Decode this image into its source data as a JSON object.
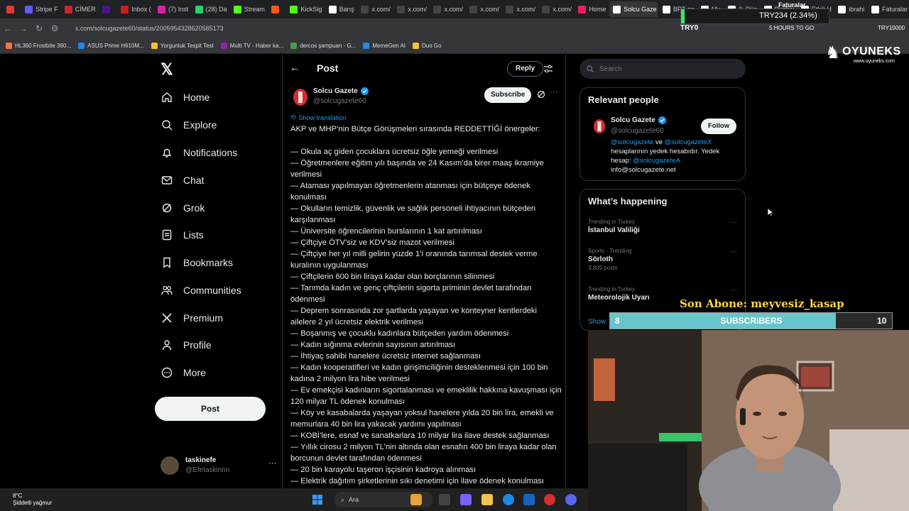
{
  "browser": {
    "tabs": [
      {
        "label": "",
        "color": "#e53935"
      },
      {
        "label": "Stripe F",
        "color": "#635bff"
      },
      {
        "label": "CİMER",
        "color": "#c62828"
      },
      {
        "label": "",
        "color": "#4a148c"
      },
      {
        "label": "Inbox (",
        "color": "#c5221f"
      },
      {
        "label": "(7) Inst",
        "color": "#d6249f"
      },
      {
        "label": "(28) Da",
        "color": "#25d366"
      },
      {
        "label": "Stream",
        "color": "#53fc18"
      },
      {
        "label": "",
        "color": "#ff5722"
      },
      {
        "label": "KickSig",
        "color": "#53fc18"
      },
      {
        "label": "Barış",
        "color": "#fff"
      },
      {
        "label": "x.com/",
        "color": "#444"
      },
      {
        "label": "x.com/",
        "color": "#444"
      },
      {
        "label": "x.com/",
        "color": "#444"
      },
      {
        "label": "x.com/",
        "color": "#444"
      },
      {
        "label": "x.com/",
        "color": "#444"
      },
      {
        "label": "x.com/",
        "color": "#444"
      },
      {
        "label": "Home",
        "color": "#e91e63"
      },
      {
        "label": "Solcu Gaze",
        "color": "#fff",
        "active": true
      },
      {
        "label": "BPT on",
        "color": "#fff"
      },
      {
        "label": "Mu",
        "color": "#fff"
      },
      {
        "label": "3. Dün",
        "color": "#fff"
      },
      {
        "label": "Puzhoi",
        "color": "#fff"
      },
      {
        "label": "Etkili H",
        "color": "#fff"
      },
      {
        "label": "ibrahi",
        "color": "#fff"
      },
      {
        "label": "Faturalar",
        "color": "#fff"
      }
    ],
    "url": "x.com/solcugazete60/status/2005954328620585173",
    "bookmarks": [
      {
        "label": "HL360 Frostbite 360...",
        "color": "#ff7043"
      },
      {
        "label": "ASUS Prime H610M...",
        "color": "#1e88e5"
      },
      {
        "label": "Yorgunluk Tespit Test",
        "color": "#fbc02d"
      },
      {
        "label": "Multi TV - Haber ka...",
        "color": "#8e24aa"
      },
      {
        "label": "dercos şampuan - G...",
        "color": "#43a047"
      },
      {
        "label": "MemeGen AI",
        "color": "#1e88e5"
      },
      {
        "label": "Duo Go",
        "color": "#fbc02d"
      }
    ]
  },
  "overlay": {
    "faturalar": "Faturalar",
    "ticker_value": "TRY234 (2.34%)",
    "ticker_progress": 0.0234,
    "ticker_sub": "TRY0",
    "hours_left": "5 HOURS TO GO",
    "ticker_goal": "TRY10000",
    "brand": "OYUNEKS",
    "brand_url": "www.oyuneks.com",
    "last_sub_label": "Son Abone: meyvesiz_kasap",
    "sub_current": "8",
    "sub_title": "SUBSCRIBERS",
    "sub_goal": "10",
    "sub_progress": 0.8
  },
  "sidebar": {
    "items": [
      {
        "label": "Home",
        "icon": "home-icon"
      },
      {
        "label": "Explore",
        "icon": "search-icon"
      },
      {
        "label": "Notifications",
        "icon": "bell-icon"
      },
      {
        "label": "Chat",
        "icon": "envelope-icon"
      },
      {
        "label": "Grok",
        "icon": "grok-icon"
      },
      {
        "label": "Lists",
        "icon": "list-icon"
      },
      {
        "label": "Bookmarks",
        "icon": "bookmark-icon"
      },
      {
        "label": "Communities",
        "icon": "people-icon"
      },
      {
        "label": "Premium",
        "icon": "x-icon"
      },
      {
        "label": "Profile",
        "icon": "person-icon"
      },
      {
        "label": "More",
        "icon": "more-circle-icon"
      }
    ],
    "post_label": "Post",
    "user": {
      "name": "taskinefe",
      "handle": "@Efetaskinnn"
    }
  },
  "post": {
    "header_title": "Post",
    "reply_label": "Reply",
    "author_name": "Solcu Gazete",
    "author_handle": "@solcugazete60",
    "subscribe_label": "Subscribe",
    "translate_label": "Show translation",
    "intro": "AKP ve MHP’nin Bütçe Görüşmeleri sırasında REDDETTİĞİ önergeler:",
    "lines": [
      "— Okula aç giden çocuklara ücretsiz öğle yemeği verilmesi",
      "— Öğretmenlere eğitim yılı başında ve 24 Kasım’da birer maaş ikramiye verilmesi",
      "— Ataması yapılmayan öğretmenlerin atanması için bütçeye ödenek konulması",
      "— Okulların temizlik, güvenlik ve sağlık personeli ihtiyacının bütçeden karşılanması",
      "— Üniversite öğrencilerinin burslarının 1 kat artırılması",
      "— Çiftçiye ÖTV’siz ve KDV’siz mazot verilmesi",
      "— Çiftçiye her yıl milli gelirin yüzde 1’i oranında tarımsal destek verme kuralının uygulanması",
      "— Çiftçilerin 600 bin liraya kadar olan borçlarının silinmesi",
      "— Tarımda kadın ve genç çiftçilerin sigorta priminin devlet tarafından ödenmesi",
      "— Deprem sonrasında zor şartlarda yaşayan ve konteyner kentlerdeki ailelere 2 yıl ücretsiz elektrik verilmesi",
      "— Boşanmış ve çocuklu kadınlara bütçeden yardım ödenmesi",
      "— Kadın sığınma evlerinin sayısının artırılması",
      "— İhtiyaç sahibi hanelere ücretsiz internet sağlanması",
      "— Kadın kooperatifleri ve kadın girişimciliğinin desteklenmesi için 100 bin kadına 2 milyon lira hibe verilmesi",
      "— Ev emekçisi kadınların sigortalanması ve emeklilik hakkına kavuşması için 120 milyar TL ödenek konulması",
      "— Köy ve kasabalarda yaşayan yoksul hanelere yılda 20 bin lira, emekli ve memurlara 40 bin lira yakacak yardımı yapılması",
      "— KOBİ’lere, esnaf ve sanatkarlara 10 milyar lira ilave destek sağlanması",
      "— Yıllık cirosu 2 milyon TL’nin altında olan esnafın 400 bin liraya kadar olan borcunun devlet tarafından ödenmesi",
      "— 20 bin karayolu taşeron işçisinin kadroya alınması",
      "— Elektrik dağıtım şirketlerinin sıkı denetimi için ilave ödenek konulması"
    ]
  },
  "right": {
    "search_placeholder": "Search",
    "relevant_title": "Relevant people",
    "rp_name": "Solcu Gazete",
    "rp_handle": "@solcugazete60",
    "follow_label": "Follow",
    "rp_bio_link1": "@solcugazete",
    "rp_bio_and": " ve ",
    "rp_bio_link2": "@solcugazeteX",
    "rp_bio_text": " hesaplarının yedek hesabıdır. Yedek hesap: ",
    "rp_bio_link3": "@solcugazeteA",
    "rp_bio_email": "info@solcugazete.net",
    "happening_title": "What’s happening",
    "trends": [
      {
        "meta": "Trending in Turkey",
        "title": "İstanbul Valiliği",
        "posts": ""
      },
      {
        "meta": "Sports · Trending",
        "title": "Sörloth",
        "posts": "3,805 posts"
      },
      {
        "meta": "Trending in Turkey",
        "title": "Meteorolojik Uyarı",
        "posts": ""
      }
    ],
    "show_more": "Show"
  },
  "taskbar": {
    "temp": "8°C",
    "weather": "Şiddetli yağmur",
    "search_label": "Ara"
  }
}
